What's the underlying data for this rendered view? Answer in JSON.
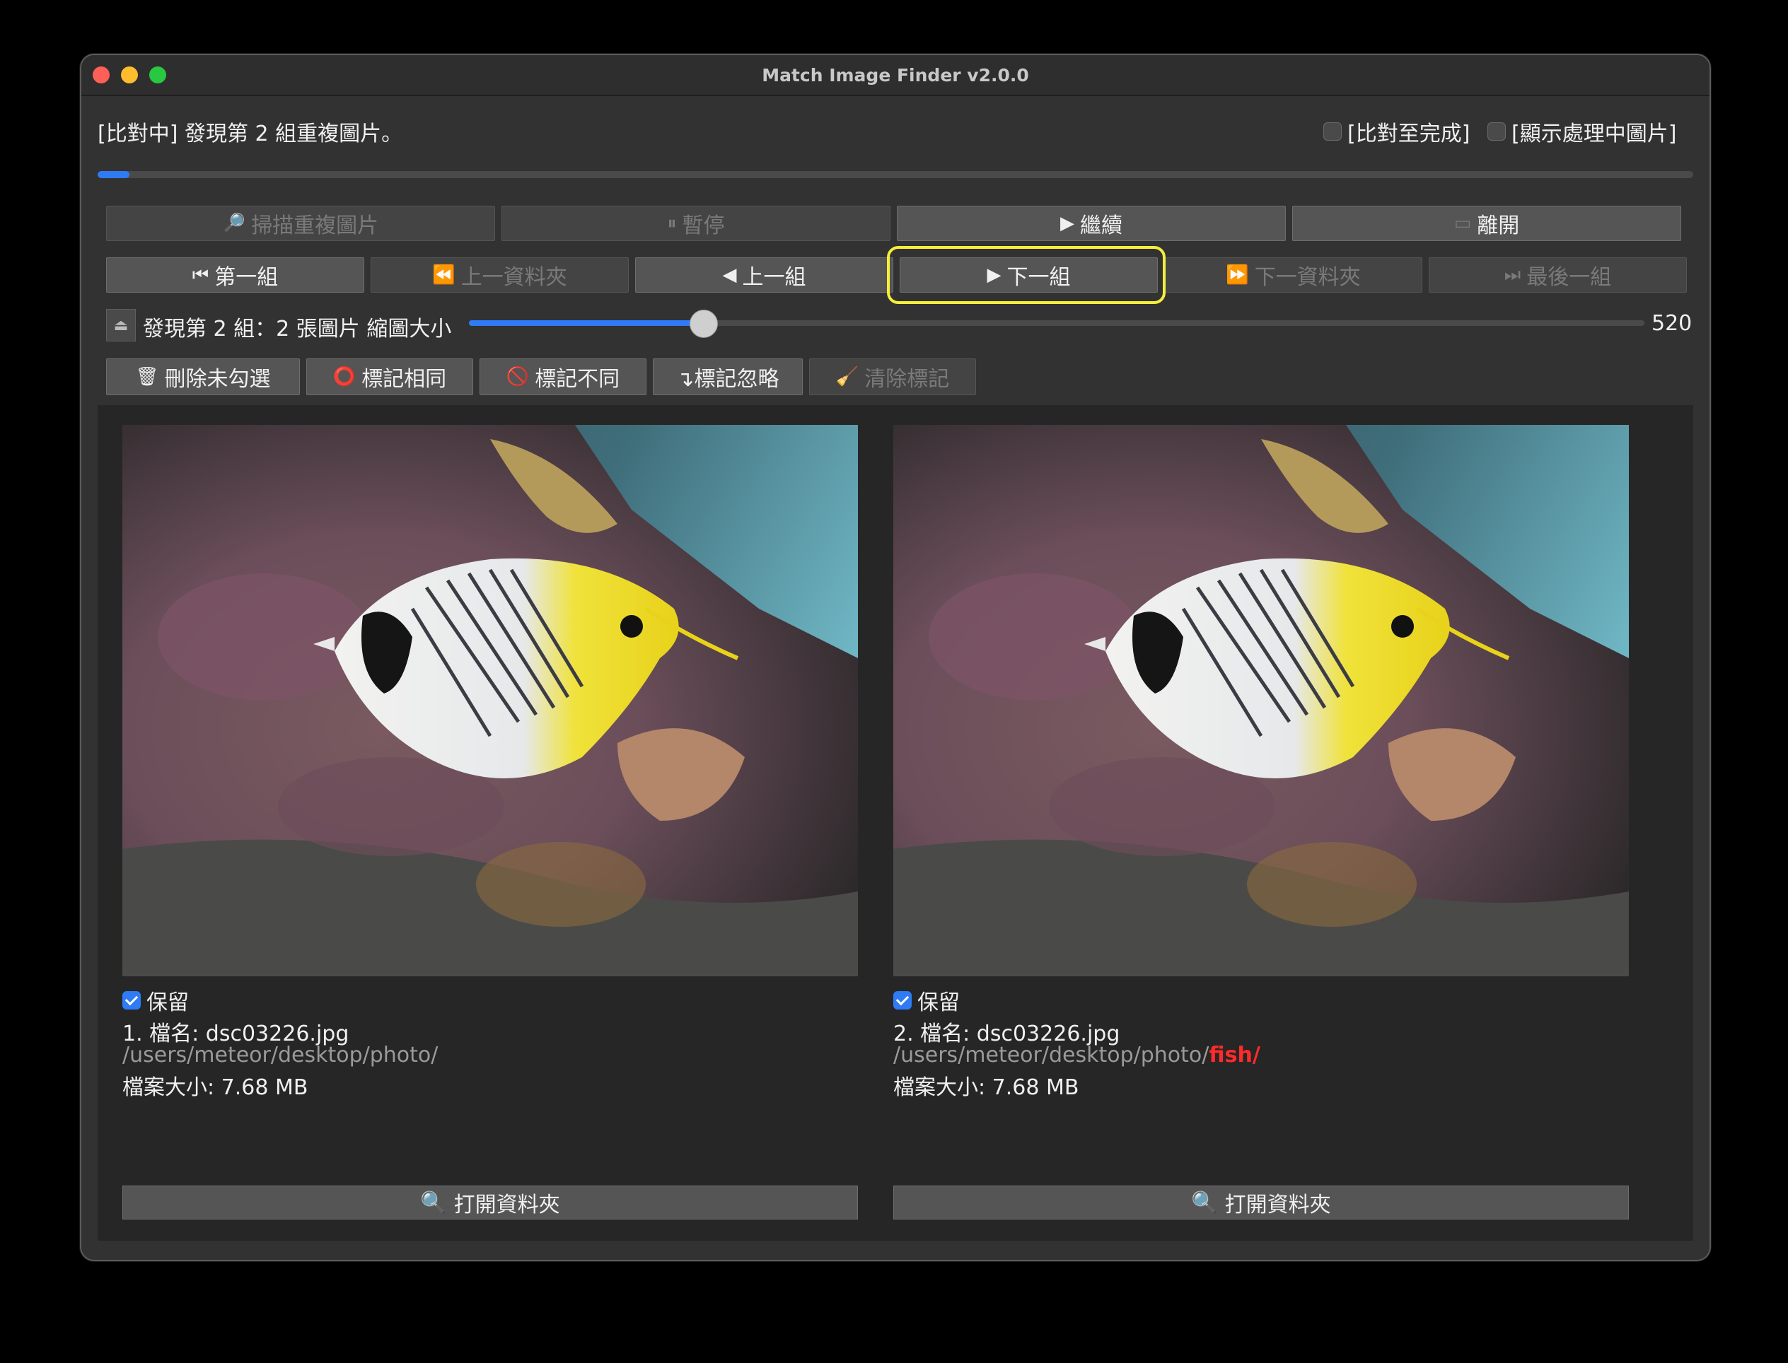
{
  "window": {
    "title": "Match Image Finder v2.0.0"
  },
  "status": {
    "message": "[比對中] 發現第 2 組重複圖片。",
    "compare_to_end_label": "[比對至完成]",
    "compare_to_end_checked": false,
    "show_processing_label": "[顯示處理中圖片]",
    "show_processing_checked": false,
    "progress_fraction": 0.02
  },
  "toolbar1": {
    "scan": {
      "label": "掃描重複圖片",
      "icon": "magnifier-icon",
      "enabled": false
    },
    "pause": {
      "label": "暫停",
      "icon": "pause-icon",
      "enabled": false
    },
    "resume": {
      "label": "繼續",
      "icon": "play-icon",
      "enabled": true
    },
    "quit": {
      "label": "離開",
      "icon": "exit-icon",
      "enabled": true
    }
  },
  "toolbar2": {
    "first": {
      "label": "第一組",
      "icon": "skip-first-icon",
      "enabled": true
    },
    "prev_folder": {
      "label": "上一資料夾",
      "icon": "rewind-icon",
      "enabled": false
    },
    "prev": {
      "label": "上一組",
      "icon": "triangle-left-icon",
      "enabled": true
    },
    "next": {
      "label": "下一組",
      "icon": "triangle-right-icon",
      "enabled": true
    },
    "next_folder": {
      "label": "下一資料夾",
      "icon": "fast-forward-icon",
      "enabled": false
    },
    "last": {
      "label": "最後一組",
      "icon": "skip-last-icon",
      "enabled": false
    }
  },
  "thumbnail": {
    "group_label": "發現第 2 組：2 張圖片 縮圖大小",
    "value": 520,
    "value_text": "520",
    "slider_fraction": 0.2
  },
  "actions": {
    "delete_unchecked": {
      "label": "刪除未勾選",
      "icon": "trash-icon",
      "enabled": true
    },
    "mark_same": {
      "label": "標記相同",
      "icon": "red-circle-icon",
      "enabled": true
    },
    "mark_different": {
      "label": "標記不同",
      "icon": "prohibited-icon",
      "enabled": true
    },
    "mark_ignore": {
      "label": "↴標記忽略",
      "icon": "return-arrow-icon",
      "enabled": true
    },
    "clear_marks": {
      "label": "清除標記",
      "icon": "broom-icon",
      "enabled": false
    }
  },
  "images": [
    {
      "keep_label": "保留",
      "keep_checked": true,
      "filename": "1. 檔名: dsc03226.jpg",
      "path_base": "/users/meteor/desktop/photo/",
      "path_diff": "",
      "size": "檔案大小: 7.68 MB",
      "open_label": "打開資料夾",
      "open_icon": "magnifier-icon"
    },
    {
      "keep_label": "保留",
      "keep_checked": true,
      "filename": "2. 檔名: dsc03226.jpg",
      "path_base": "/users/meteor/desktop/photo/",
      "path_diff": "fish/",
      "size": "檔案大小: 7.68 MB",
      "open_label": "打開資料夾",
      "open_icon": "magnifier-icon"
    }
  ],
  "colors": {
    "accent": "#2f7bf6",
    "highlight": "#f3ef3b",
    "path_diff": "#ff2b2b"
  }
}
